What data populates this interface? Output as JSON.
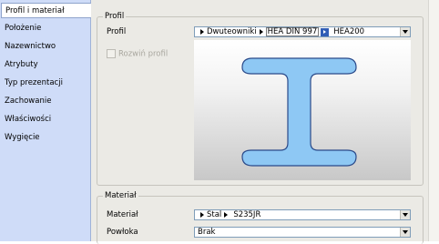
{
  "sidebar": {
    "items": [
      {
        "label": "Profil i materiał",
        "active": true
      },
      {
        "label": "Położenie"
      },
      {
        "label": "Nazewnictwo"
      },
      {
        "label": "Atrybuty"
      },
      {
        "label": "Typ prezentacji"
      },
      {
        "label": "Zachowanie"
      },
      {
        "label": "Właściwości"
      },
      {
        "label": "Wygięcie"
      }
    ]
  },
  "profil_group": {
    "legend": "Profil",
    "profil_label": "Profil",
    "profil_path": [
      "Dwuteowniki",
      "HEA DIN 997",
      "HEA200"
    ],
    "expand_label": "Rozwiń profil",
    "preview_shape": "I-beam-icon"
  },
  "material_group": {
    "legend": "Materiał",
    "material_label": "Materiał",
    "material_path": [
      "Stal",
      "S235JR"
    ],
    "coating_label": "Powłoka",
    "coating_value": "Brak"
  },
  "colors": {
    "sidebar_bg": "#cfdcf8",
    "panel_bg": "#ebeae5",
    "beam_fill": "#8ec8f4",
    "beam_stroke": "#2a4a8a",
    "selection": "#315eb6"
  }
}
